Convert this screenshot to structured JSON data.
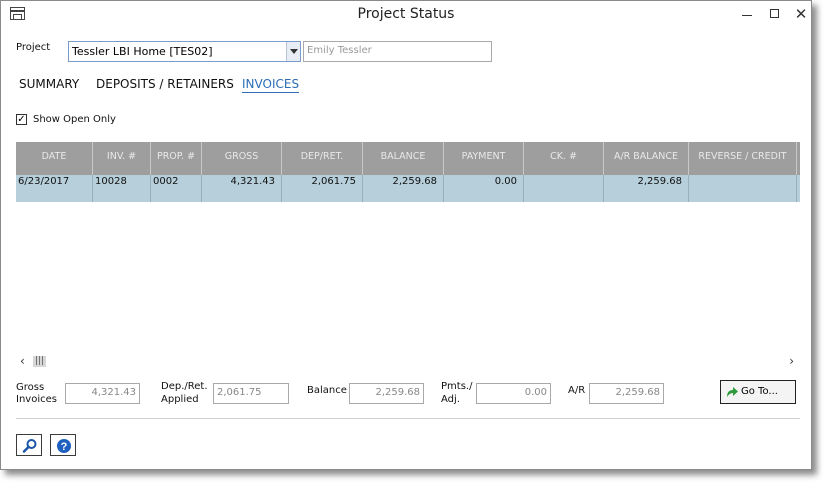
{
  "window": {
    "title": "Project Status"
  },
  "project": {
    "label": "Project",
    "selected": "Tessler LBI Home [TES02]",
    "client_name_placeholder": "Emily Tessler"
  },
  "tabs": [
    {
      "label": "SUMMARY",
      "active": false
    },
    {
      "label": "DEPOSITS / RETAINERS",
      "active": false
    },
    {
      "label": "INVOICES",
      "active": true
    }
  ],
  "filter": {
    "show_open_only_label": "Show Open Only",
    "checked": true
  },
  "grid": {
    "columns": [
      "DATE",
      "INV. #",
      "PROP. #",
      "GROSS",
      "DEP/RET.",
      "BALANCE",
      "PAYMENT",
      "CK. #",
      "A/R BALANCE",
      "REVERSE / CREDIT"
    ],
    "rows": [
      [
        "6/23/2017",
        "10028",
        "0002",
        "4,321.43",
        "2,061.75",
        "2,259.68",
        "0.00",
        "",
        "2,259.68",
        ""
      ]
    ]
  },
  "totals": {
    "gross_label_1": "Gross",
    "gross_label_2": "Invoices",
    "gross_value": "4,321.43",
    "dep_label_1": "Dep./Ret.",
    "dep_label_2": "Applied",
    "dep_value": "2,061.75",
    "balance_label": "Balance",
    "balance_value": "2,259.68",
    "pmts_label_1": "Pmts./",
    "pmts_label_2": "Adj.",
    "pmts_value": "0.00",
    "ar_label": "A/R",
    "ar_value": "2,259.68"
  },
  "goto_button": {
    "label": "Go To..."
  },
  "icons": {
    "search": "magnifier-icon",
    "help": "question-circle-icon",
    "goto": "green-arrow-icon"
  },
  "colors": {
    "accent": "#2c6db5",
    "row_selected": "#b6cfda",
    "header_bg": "#9e9e9e"
  }
}
